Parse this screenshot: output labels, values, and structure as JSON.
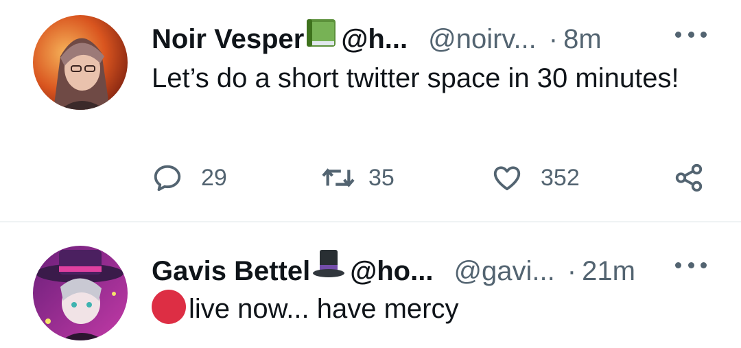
{
  "tweets": [
    {
      "name": "Noir Vesper",
      "emoji_icon": "green-book-icon",
      "handle_trunc": "@h...",
      "username": "@noirv...",
      "separator": "·",
      "time": "8m",
      "text": "Let’s do a short twitter space in 30 minutes!",
      "actions": {
        "replies": "29",
        "retweets": "35",
        "likes": "352"
      }
    },
    {
      "name": "Gavis Bettel",
      "emoji_icon": "top-hat-icon",
      "handle_trunc": "@ho...",
      "username": "@gavi...",
      "separator": "·",
      "time": "21m",
      "text_icon": "red-circle-icon",
      "text": "live now... have mercy"
    }
  ],
  "colors": {
    "text_primary": "#0f1419",
    "text_secondary": "#536471",
    "divider": "#eff3f4",
    "live_red": "#dd2e44"
  }
}
